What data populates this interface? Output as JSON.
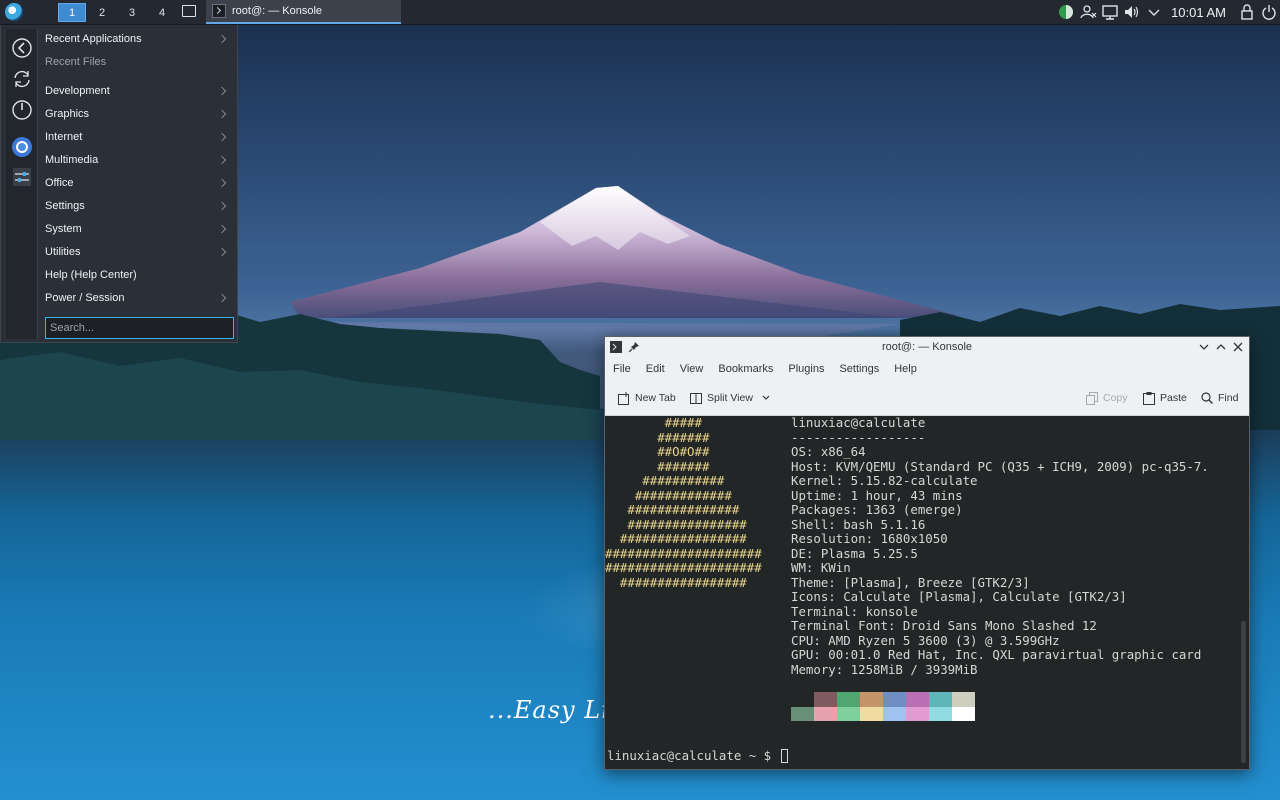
{
  "panel": {
    "pager": [
      "1",
      "2",
      "3",
      "4"
    ],
    "task_label": "root@: — Konsole",
    "clock": "10:01 AM"
  },
  "menu": {
    "categories": [
      {
        "label": "Recent Applications",
        "submenu": true,
        "dim": false
      },
      {
        "label": "Recent Files",
        "submenu": false,
        "dim": true
      },
      {
        "label": "Development",
        "submenu": true,
        "dim": false
      },
      {
        "label": "Graphics",
        "submenu": true,
        "dim": false
      },
      {
        "label": "Internet",
        "submenu": true,
        "dim": false
      },
      {
        "label": "Multimedia",
        "submenu": true,
        "dim": false
      },
      {
        "label": "Office",
        "submenu": true,
        "dim": false
      },
      {
        "label": "Settings",
        "submenu": true,
        "dim": false
      },
      {
        "label": "System",
        "submenu": true,
        "dim": false
      },
      {
        "label": "Utilities",
        "submenu": true,
        "dim": false
      },
      {
        "label": "Help (Help Center)",
        "submenu": false,
        "dim": false
      },
      {
        "label": "Power / Session",
        "submenu": true,
        "dim": false
      }
    ],
    "search_placeholder": "Search..."
  },
  "wallpaper": {
    "slogan": "...Easy Lin"
  },
  "konsole": {
    "title": "root@: — Konsole",
    "menus": [
      "File",
      "Edit",
      "View",
      "Bookmarks",
      "Plugins",
      "Settings",
      "Help"
    ],
    "toolbar": {
      "new_tab": "New Tab",
      "split_view": "Split View",
      "copy": "Copy",
      "paste": "Paste",
      "find": "Find"
    },
    "logo": [
      "        #####",
      "       #######",
      "       ##O#O##",
      "       #######",
      "     ###########",
      "    #############",
      "   ###############",
      "   ################",
      "  #################",
      "#####################",
      "#####################",
      "  #################"
    ],
    "info": [
      "linuxiac@calculate",
      "------------------",
      "OS: x86_64",
      "Host: KVM/QEMU (Standard PC (Q35 + ICH9, 2009) pc-q35-7.",
      "Kernel: 5.15.82-calculate",
      "Uptime: 1 hour, 43 mins",
      "Packages: 1363 (emerge)",
      "Shell: bash 5.1.16",
      "Resolution: 1680x1050",
      "DE: Plasma 5.25.5",
      "WM: KWin",
      "Theme: [Plasma], Breeze [GTK2/3]",
      "Icons: Calculate [Plasma], Calculate [GTK2/3]",
      "Terminal: konsole",
      "Terminal Font: Droid Sans Mono Slashed 12",
      "CPU: AMD Ryzen 5 3600 (3) @ 3.599GHz",
      "GPU: 00:01.0 Red Hat, Inc. QXL paravirtual graphic card",
      "Memory: 1258MiB / 3939MiB"
    ],
    "palette_top": [
      "#232627",
      "#7f5a5f",
      "#4fa76f",
      "#c5946a",
      "#6f8fc4",
      "#b86fb3",
      "#5fb5b8",
      "#cfcfbf"
    ],
    "palette_bottom": [
      "#6a8f78",
      "#e6a3ad",
      "#7fd09a",
      "#f0dca0",
      "#9fc2f0",
      "#e39ad3",
      "#8fdde0",
      "#ffffff"
    ],
    "prompt": "linuxiac@calculate ~ $ "
  }
}
